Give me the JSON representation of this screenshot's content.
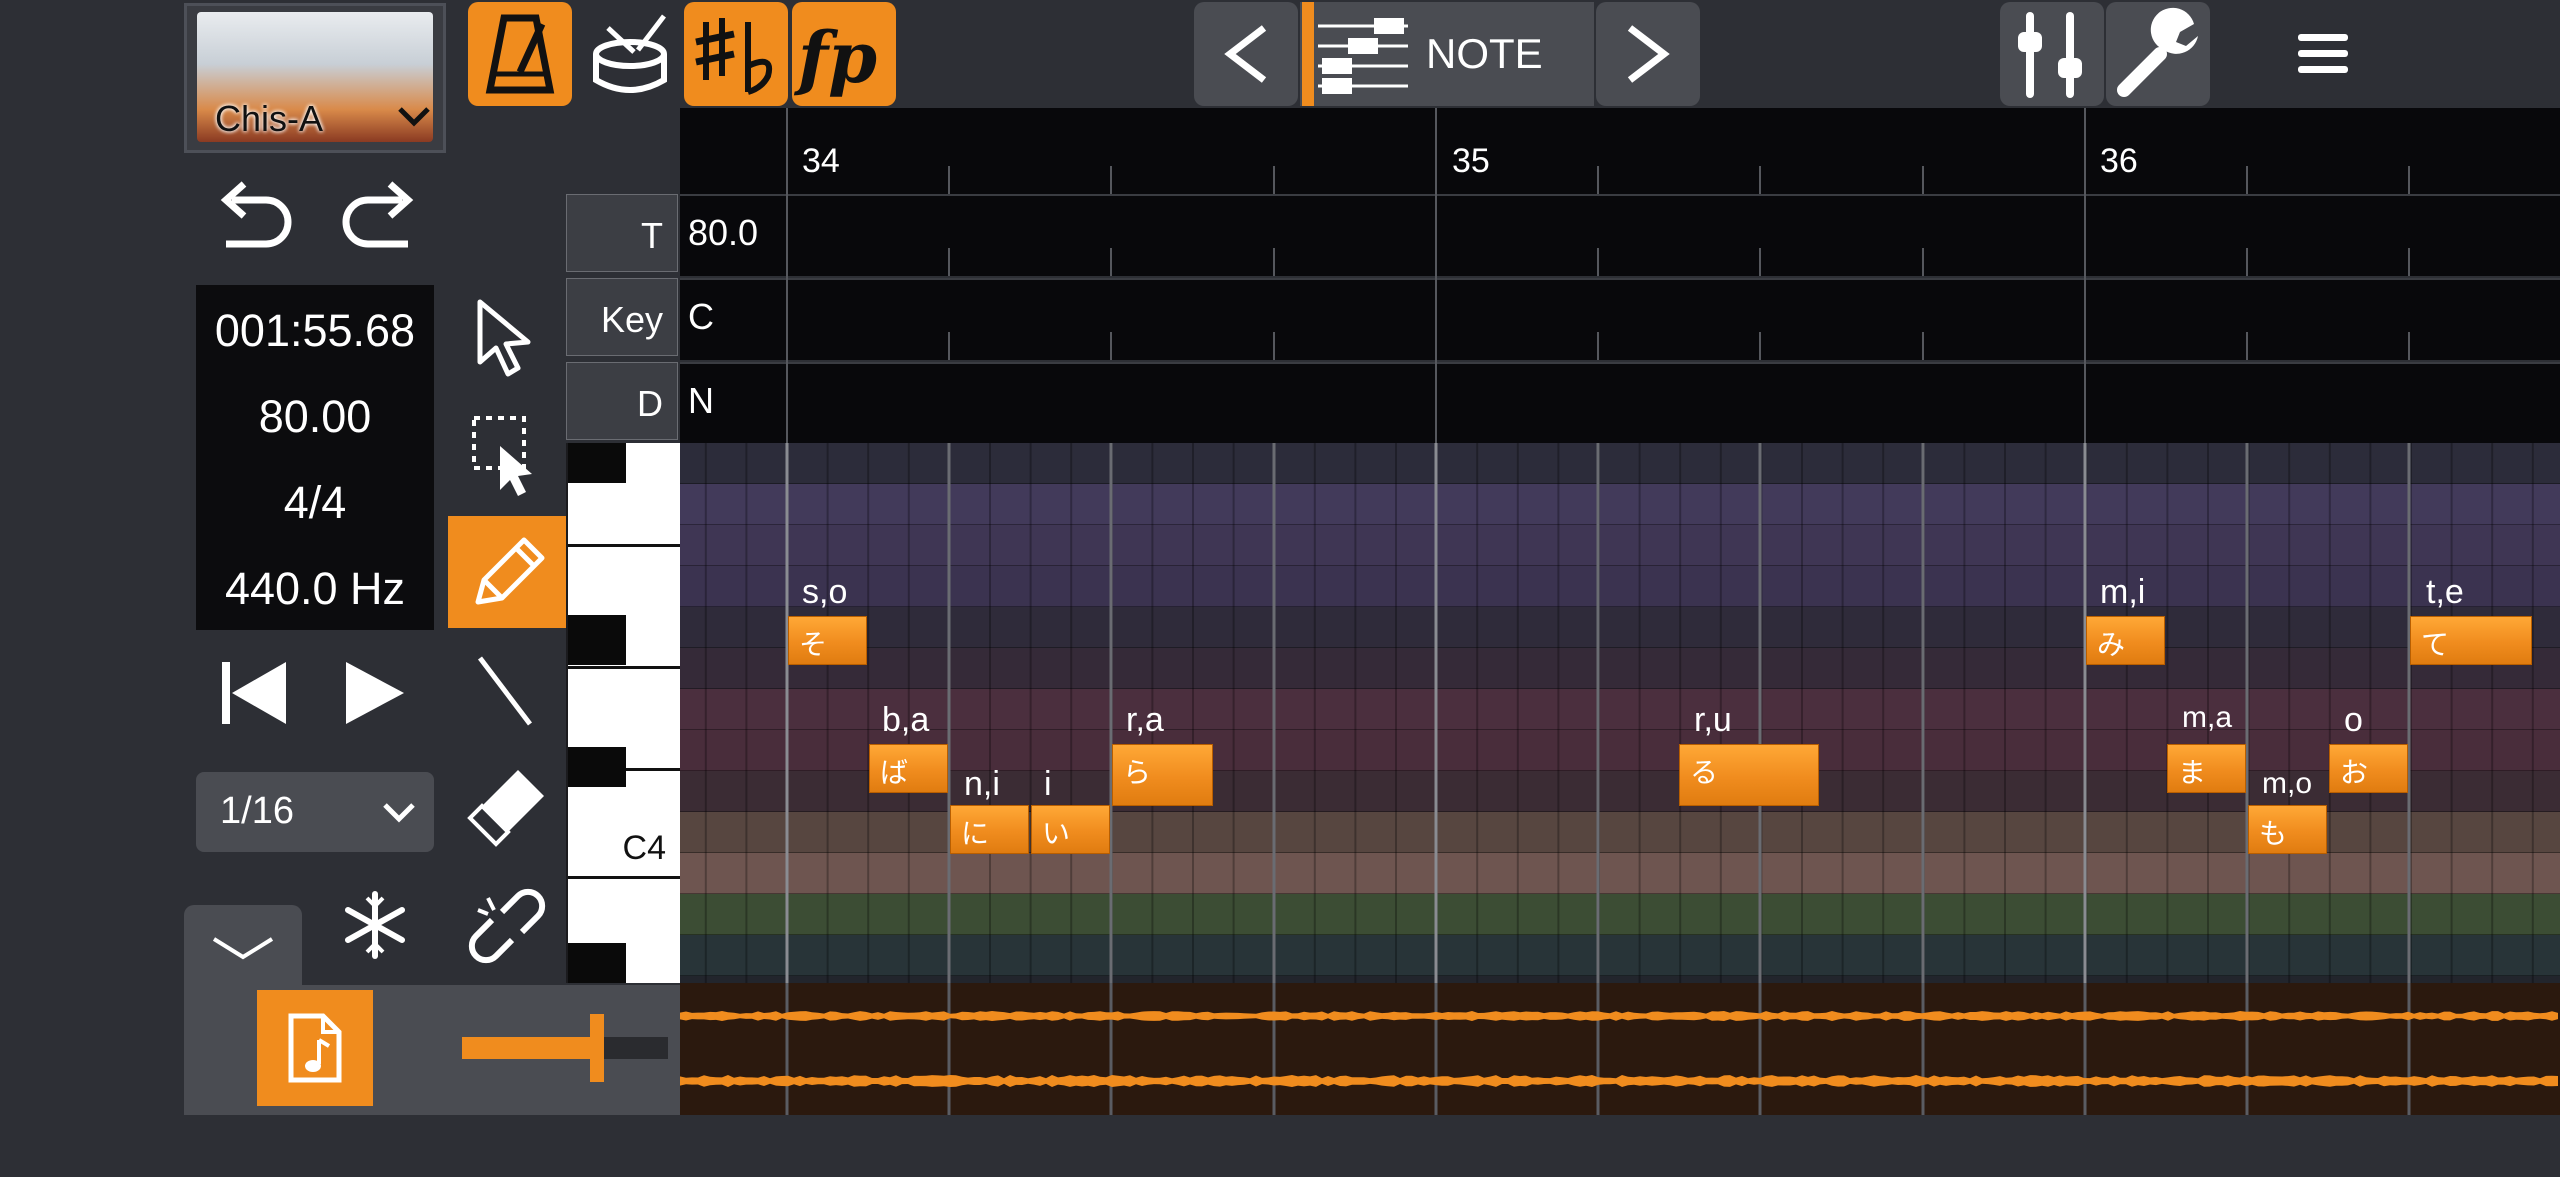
{
  "singer": {
    "name": "Chis-A"
  },
  "display": {
    "time": "001:55.68",
    "tempo": "80.00",
    "meter": "4/4",
    "pitch": "440.0 Hz"
  },
  "quantize": "1/16",
  "nav": {
    "mode": "NOTE"
  },
  "ruler": {
    "bars": [
      "34",
      "35",
      "36"
    ]
  },
  "params": [
    {
      "label": "T",
      "value": "80.0"
    },
    {
      "label": "Key",
      "value": "C"
    },
    {
      "label": "D",
      "value": "N"
    }
  ],
  "piano": {
    "c4_label": "C4"
  },
  "notes": [
    {
      "lyric": "そ",
      "phoneme": "s,o"
    },
    {
      "lyric": "ば",
      "phoneme": "b,a"
    },
    {
      "lyric": "に",
      "phoneme": "n,i"
    },
    {
      "lyric": "い",
      "phoneme": "i"
    },
    {
      "lyric": "ら",
      "phoneme": "r,a"
    },
    {
      "lyric": "る",
      "phoneme": "r,u"
    },
    {
      "lyric": "み",
      "phoneme": "m,i"
    },
    {
      "lyric": "ま",
      "phoneme": "m,a"
    },
    {
      "lyric": "も",
      "phoneme": "m,o"
    },
    {
      "lyric": "お",
      "phoneme": "o"
    },
    {
      "lyric": "て",
      "phoneme": "t,e"
    }
  ],
  "colors": {
    "accent": "#f08c1e",
    "background": "#2d2f35",
    "panel": "#4a4c52"
  },
  "icons": [
    "metronome-icon",
    "drum-icon",
    "sharp-flat-icon",
    "dynamics-fp-icon",
    "mixer-sliders-icon",
    "wrench-icon",
    "hamburger-menu-icon",
    "undo-icon",
    "redo-icon",
    "rewind-icon",
    "play-icon",
    "arrow-select-icon",
    "box-select-icon",
    "pencil-icon",
    "line-icon",
    "eraser-icon",
    "snowflake-icon",
    "unlink-icon",
    "music-file-icon"
  ]
}
